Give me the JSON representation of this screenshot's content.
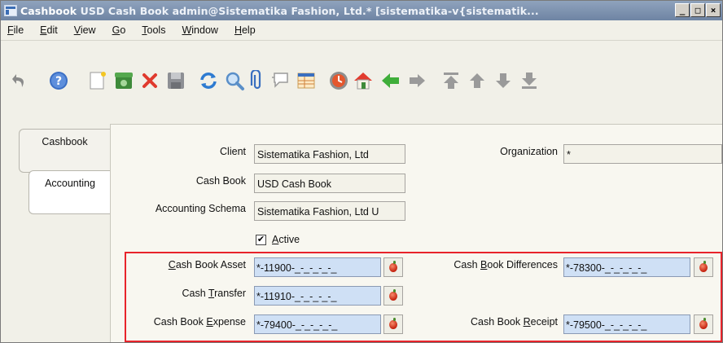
{
  "window": {
    "title_bold": "Cashbook ",
    "title_rest": " USD Cash Book  admin@Sistematika Fashion, Ltd.* [sistematika-v{sistematik..."
  },
  "controls": {
    "minimize": "_",
    "maximize": "□",
    "close": "×"
  },
  "menu": [
    {
      "pre": "",
      "key": "F",
      "post": "ile"
    },
    {
      "pre": "",
      "key": "E",
      "post": "dit"
    },
    {
      "pre": "",
      "key": "V",
      "post": "iew"
    },
    {
      "pre": "",
      "key": "G",
      "post": "o"
    },
    {
      "pre": "",
      "key": "T",
      "post": "ools"
    },
    {
      "pre": "",
      "key": "W",
      "post": "indow"
    },
    {
      "pre": "",
      "key": "H",
      "post": "elp"
    }
  ],
  "toolbar_icons": [
    "undo-icon",
    "help-icon",
    "new-record-icon",
    "copy-record-icon",
    "delete-icon",
    "save-icon",
    "refresh-icon",
    "find-icon",
    "attachment-icon",
    "chat-icon",
    "grid-toggle-icon",
    "history-icon",
    "home-icon",
    "previous-icon",
    "next-icon",
    "first-icon",
    "up-icon",
    "down-icon",
    "last-icon"
  ],
  "tabs": {
    "cashbook": "Cashbook",
    "accounting": "Accounting"
  },
  "form": {
    "client_label": "Client",
    "client_value": "Sistematika Fashion, Ltd",
    "org_label": "Organization",
    "org_value": "*",
    "cashbook_label": "Cash Book",
    "cashbook_value": "USD Cash Book",
    "schema_label": "Accounting Schema",
    "schema_value": "Sistematika Fashion, Ltd U",
    "active_label_key": "A",
    "active_label_rest": "ctive",
    "active_checked": "✔",
    "asset_label_key": "C",
    "asset_label_rest": "ash Book Asset",
    "asset_value": "*-11900-_-_-_-_-_",
    "diff_label_pre": "Cash ",
    "diff_label_key": "B",
    "diff_label_rest": "ook Differences",
    "diff_value": "*-78300-_-_-_-_-_",
    "transfer_label_pre": "Cash ",
    "transfer_label_key": "T",
    "transfer_label_rest": "ransfer",
    "transfer_value": "*-11910-_-_-_-_-_",
    "expense_label_pre": "Cash Book ",
    "expense_label_key": "E",
    "expense_label_rest": "xpense",
    "expense_value": "*-79400-_-_-_-_-_",
    "receipt_label_pre": "Cash Book ",
    "receipt_label_key": "R",
    "receipt_label_rest": "eceipt",
    "receipt_value": "*-79500-_-_-_-_-_"
  },
  "colors": {
    "highlight": "#e8232b",
    "account_field": "#cfe0f5",
    "titlebar": "#7a8fad"
  }
}
